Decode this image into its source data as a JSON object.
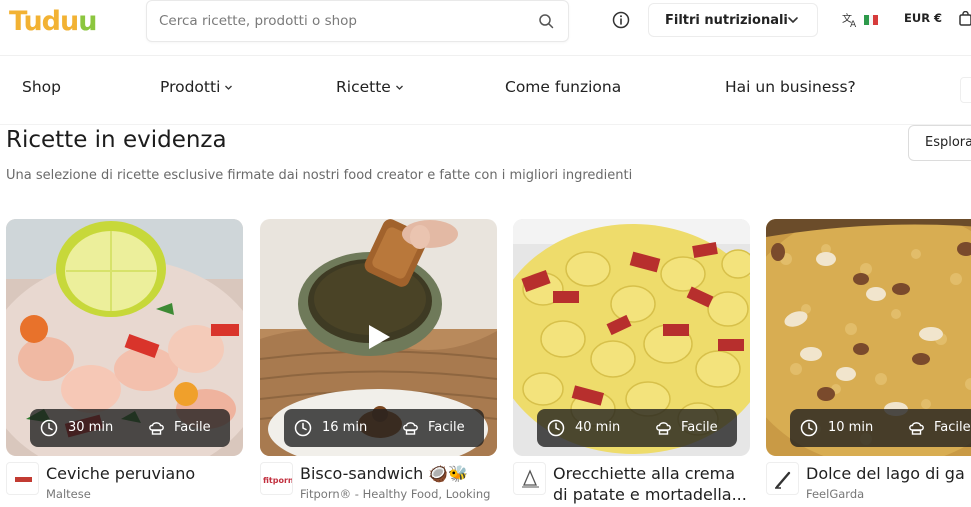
{
  "header": {
    "logo_text_a": "Tudu",
    "logo_text_b": "u",
    "search": {
      "placeholder": "Cerca ricette, prodotti o shop",
      "value": ""
    },
    "filters_label": "Filtri nutrizionali",
    "currency_label": "EUR €",
    "icons": [
      "search-icon",
      "info-icon",
      "chevron-down-icon",
      "translate-icon",
      "italy-flag-icon",
      "cart-icon"
    ]
  },
  "nav": {
    "items": [
      {
        "label": "Shop",
        "dropdown": false
      },
      {
        "label": "Prodotti",
        "dropdown": true
      },
      {
        "label": "Ricette",
        "dropdown": true
      },
      {
        "label": "Come funziona",
        "dropdown": false
      },
      {
        "label": "Hai un business?",
        "dropdown": false
      }
    ]
  },
  "section": {
    "title": "Ricette in evidenza",
    "subtitle": "Una selezione di ricette esclusive firmate dai nostri food creator e fatte con i migliori ingredienti",
    "explore_label": "Esplora"
  },
  "recipes": [
    {
      "title": "Ceviche peruviano",
      "author": "Maltese",
      "time": "30 min",
      "difficulty": "Facile",
      "video": false
    },
    {
      "title": "Bisco-sandwich 🥥🐝",
      "author": "Fitporn® - Healthy Food, Looking",
      "time": "16 min",
      "difficulty": "Facile",
      "video": true
    },
    {
      "title": "Orecchiette alla crema",
      "title_line2": "di patate e mortadella...",
      "author": "",
      "time": "40 min",
      "difficulty": "Facile",
      "video": false
    },
    {
      "title": "Dolce del lago di ga",
      "author": "FeelGarda",
      "time": "10 min",
      "difficulty": "Facile",
      "video": false
    }
  ],
  "colors": {
    "logo_orange": "#f2b233",
    "logo_green": "#8cc63f",
    "badge_bg": "#1e1e1e"
  }
}
